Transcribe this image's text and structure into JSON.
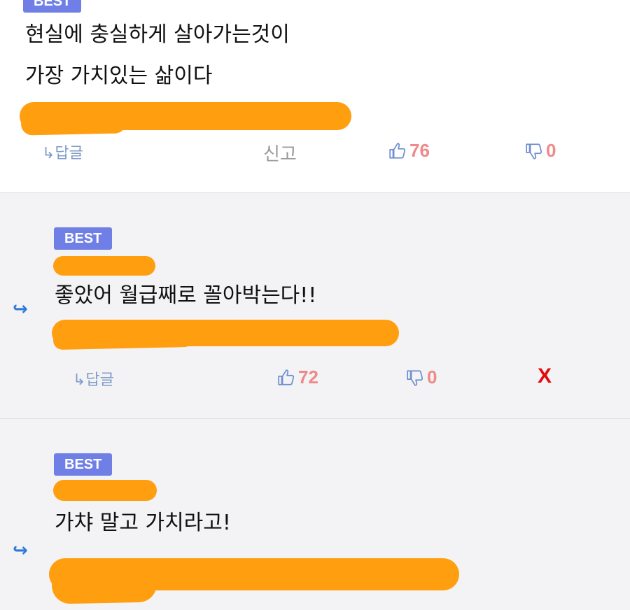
{
  "colors": {
    "badge": "#6f7fe6",
    "redaction": "#ff9f10",
    "vote_count": "#ee8a8a",
    "reply_arrow": "#2f7ad6",
    "x_mark": "#e60a0a"
  },
  "comments": [
    {
      "badge": "BEST",
      "text": "현실에 충실하게 살아가는것이\n가장 가치있는 삶이다",
      "reply_label": "↳답글",
      "report_label": "신고",
      "up_icon": "thumbs-up-icon",
      "up_count": "76",
      "down_icon": "thumbs-down-icon",
      "down_count": "0"
    },
    {
      "badge": "BEST",
      "text": "좋았어 월급째로 꼴아박는다!!",
      "reply_label": "↳답글",
      "up_icon": "thumbs-up-icon",
      "up_count": "72",
      "down_icon": "thumbs-down-icon",
      "down_count": "0",
      "mark": "X"
    },
    {
      "badge": "BEST",
      "text": "가챠 말고 가치라고!"
    }
  ]
}
